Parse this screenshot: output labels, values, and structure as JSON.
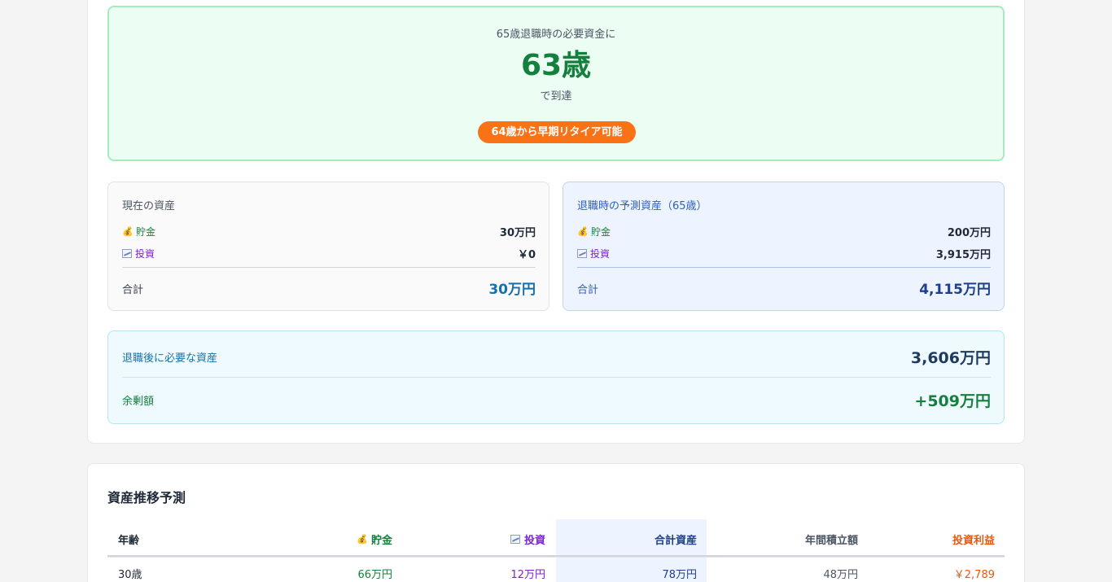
{
  "hero": {
    "subtitle": "65歳退職時の必要資金に",
    "age": "63歳",
    "reach": "で到達",
    "badge": "64歳から早期リタイア可能"
  },
  "current": {
    "title": "現在の資産",
    "savings_label": "貯金",
    "savings_value": "30万円",
    "invest_label": "投資",
    "invest_value": "￥0",
    "total_label": "合計",
    "total_value": "30万円"
  },
  "retire": {
    "title": "退職時の予測資産（65歳）",
    "savings_label": "貯金",
    "savings_value": "200万円",
    "invest_label": "投資",
    "invest_value": "3,915万円",
    "total_label": "合計",
    "total_value": "4,115万円"
  },
  "need": {
    "required_label": "退職後に必要な資産",
    "required_value": "3,606万円",
    "surplus_label": "余剰額",
    "surplus_value": "+509万円"
  },
  "table": {
    "title": "資産推移予測",
    "headers": {
      "age": "年齢",
      "savings": "貯金",
      "invest": "投資",
      "total": "合計資産",
      "annual": "年間積立額",
      "profit": "投資利益"
    },
    "rows": [
      {
        "age": "30歳",
        "savings": "66万円",
        "invest": "12万円",
        "total": "78万円",
        "annual": "48万円",
        "profit": "￥2,789"
      }
    ]
  },
  "icons": {
    "savings": "money-bag-icon",
    "invest": "chart-increasing-icon"
  },
  "colors": {
    "green": "#15803d",
    "orange": "#f97316",
    "blue": "#1e3f8a",
    "purple": "#7e22ce"
  }
}
